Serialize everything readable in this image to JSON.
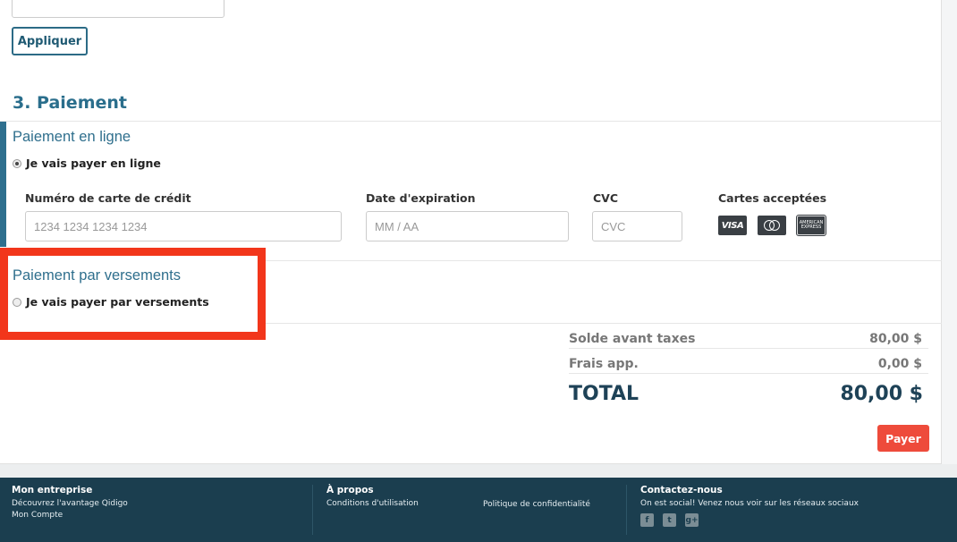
{
  "coupon": {
    "apply_label": "Appliquer",
    "value": ""
  },
  "payment": {
    "section_title": "3. Paiement",
    "online": {
      "title": "Paiement en ligne",
      "radio_label": "Je vais payer en ligne",
      "selected": true,
      "card_number": {
        "label": "Numéro de carte de crédit",
        "placeholder": "1234 1234 1234 1234"
      },
      "expiration": {
        "label": "Date d'expiration",
        "placeholder": "MM / AA"
      },
      "cvc": {
        "label": "CVC",
        "placeholder": "CVC"
      },
      "accepted_cards": {
        "label": "Cartes acceptées",
        "cards": [
          "visa-icon",
          "mastercard-icon",
          "american-express-icon"
        ],
        "visa_text": "VISA",
        "amex_text_1": "AMERICAN",
        "amex_text_2": "EXPRESS"
      }
    },
    "installments": {
      "title": "Paiement par versements",
      "radio_label": "Je vais payer par versements",
      "selected": false
    }
  },
  "summary": {
    "rows": [
      {
        "label": "Solde avant taxes",
        "value": "80,00 $"
      },
      {
        "label": "Frais app.",
        "value": "0,00 $"
      }
    ],
    "total_label": "TOTAL",
    "total_value": "80,00 $",
    "pay_label": "Payer"
  },
  "footer": {
    "company": {
      "heading": "Mon entreprise",
      "links": [
        "Découvrez l'avantage Qidigo",
        "Mon Compte"
      ]
    },
    "about": {
      "heading": "À propos",
      "links": [
        "Conditions d'utilisation",
        "Politique de confidentialité"
      ]
    },
    "contact": {
      "heading": "Contactez-nous",
      "text": "On est social! Venez nous voir sur les réseaux sociaux",
      "social": [
        "f",
        "t",
        "g+"
      ]
    }
  },
  "colors": {
    "accent": "#2a6e8c",
    "pay_button": "#ee4b3b",
    "highlight": "#f2361b",
    "footer_bg": "#1b3e4f"
  }
}
